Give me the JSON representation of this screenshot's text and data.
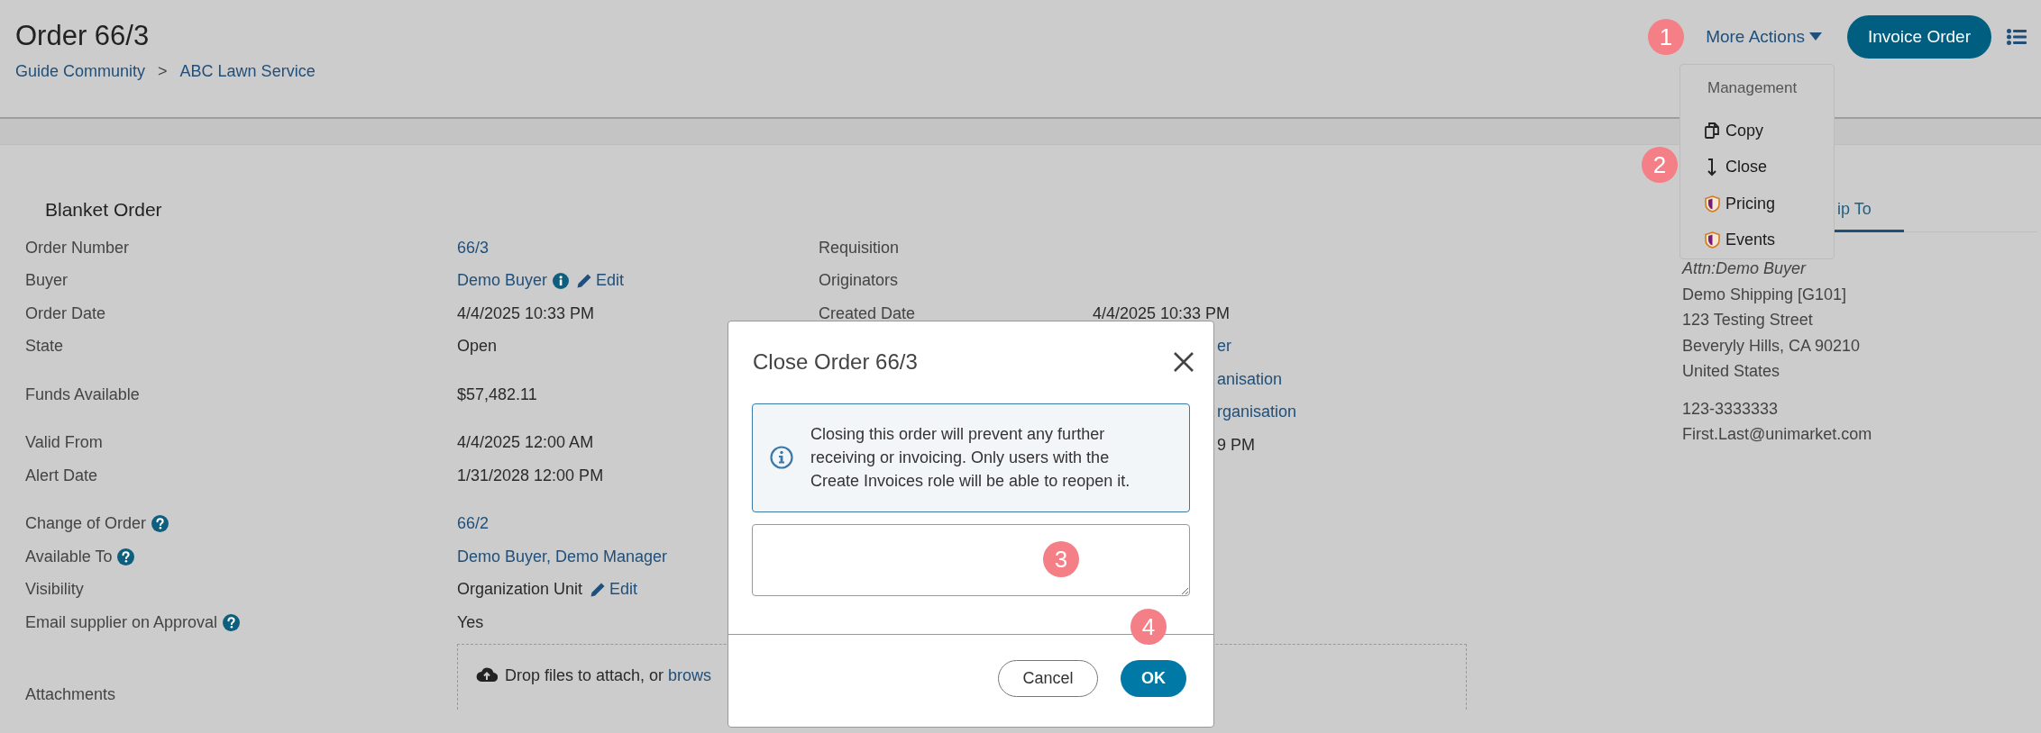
{
  "header": {
    "title": "Order 66/3",
    "breadcrumbs": [
      "Guide Community",
      "ABC Lawn Service"
    ],
    "breadcrumb_separator": ">",
    "more_actions": "More Actions",
    "primary_button": "Invoice Order"
  },
  "actions_menu": {
    "heading": "Management",
    "items": [
      {
        "label": "Copy",
        "kind": "copy"
      },
      {
        "label": "Close",
        "kind": "close"
      },
      {
        "label": "Pricing",
        "kind": "restricted"
      },
      {
        "label": "Events",
        "kind": "restricted"
      }
    ]
  },
  "details": {
    "title": "Blanket Order",
    "groups": [
      [
        {
          "kind": "field",
          "label": "Order Number",
          "help": false,
          "value": "66/3",
          "link": true,
          "info": false
        },
        {
          "kind": "field",
          "label": "Buyer",
          "help": false,
          "value": "Demo Buyer",
          "link": true,
          "info": true,
          "edit": "Edit"
        },
        {
          "kind": "field",
          "label": "Order Date",
          "help": false,
          "value": "4/4/2025 10:33 PM",
          "link": false,
          "info": false
        },
        {
          "kind": "field",
          "label": "State",
          "help": false,
          "value": "Open",
          "link": false,
          "info": false
        }
      ],
      [
        {
          "kind": "field",
          "label": "Funds Available",
          "help": false,
          "value": "$57,482.11",
          "link": false,
          "info": false
        }
      ],
      [
        {
          "kind": "field",
          "label": "Valid From",
          "help": false,
          "value": "4/4/2025 12:00 AM",
          "link": false,
          "info": false
        },
        {
          "kind": "field",
          "label": "Alert Date",
          "help": false,
          "value": "1/31/2028 12:00 PM",
          "link": false,
          "info": false
        }
      ],
      [
        {
          "kind": "field",
          "label": "Change of Order",
          "help": true,
          "value": "66/2",
          "link": true,
          "info": false
        },
        {
          "kind": "field",
          "label": "Available To",
          "help": true,
          "value": "Demo Buyer, Demo Manager",
          "link": true,
          "info": false
        },
        {
          "kind": "field",
          "label": "Visibility",
          "help": false,
          "value": "Organization Unit",
          "link": false,
          "info": false,
          "edit": "Edit"
        },
        {
          "kind": "field",
          "label": "Email supplier on Approval",
          "help": true,
          "value": "Yes",
          "link": false,
          "info": false
        },
        {
          "kind": "attachments",
          "label": "Attachments",
          "help": false,
          "drop_text": "Drop files to attach, or ",
          "drop_link": "brows"
        }
      ]
    ]
  },
  "details_middle": {
    "rows": [
      {
        "label": "Requisition"
      },
      {
        "label": "Originators"
      },
      {
        "label": "Created Date",
        "value": "4/4/2025 10:33 PM",
        "link": false
      },
      {
        "value": "er",
        "link": true
      },
      {
        "value": "anisation",
        "link": true
      },
      {
        "value": "rganisation",
        "link": true
      },
      {
        "value": "9 PM",
        "link": false
      }
    ]
  },
  "ship_to": {
    "tabs": [
      {
        "label": "ip To",
        "selected": true
      }
    ],
    "address_lines": [
      "Attn:Demo Buyer",
      "Demo Shipping [G101]",
      "123 Testing Street",
      "Beveryly Hills, CA 90210",
      "United States"
    ],
    "contact_lines": [
      "123-3333333",
      "First.Last@unimarket.com"
    ]
  },
  "dialog": {
    "title": "Close Order 66/3",
    "notice": "Closing this order will prevent any further receiving or invoicing. Only users with the Create Invoices role will be able to reopen it.",
    "buttons": [
      {
        "label": "Cancel",
        "primary": false
      },
      {
        "label": "OK",
        "primary": true
      }
    ]
  },
  "callouts": [
    "1",
    "2",
    "3",
    "4"
  ]
}
